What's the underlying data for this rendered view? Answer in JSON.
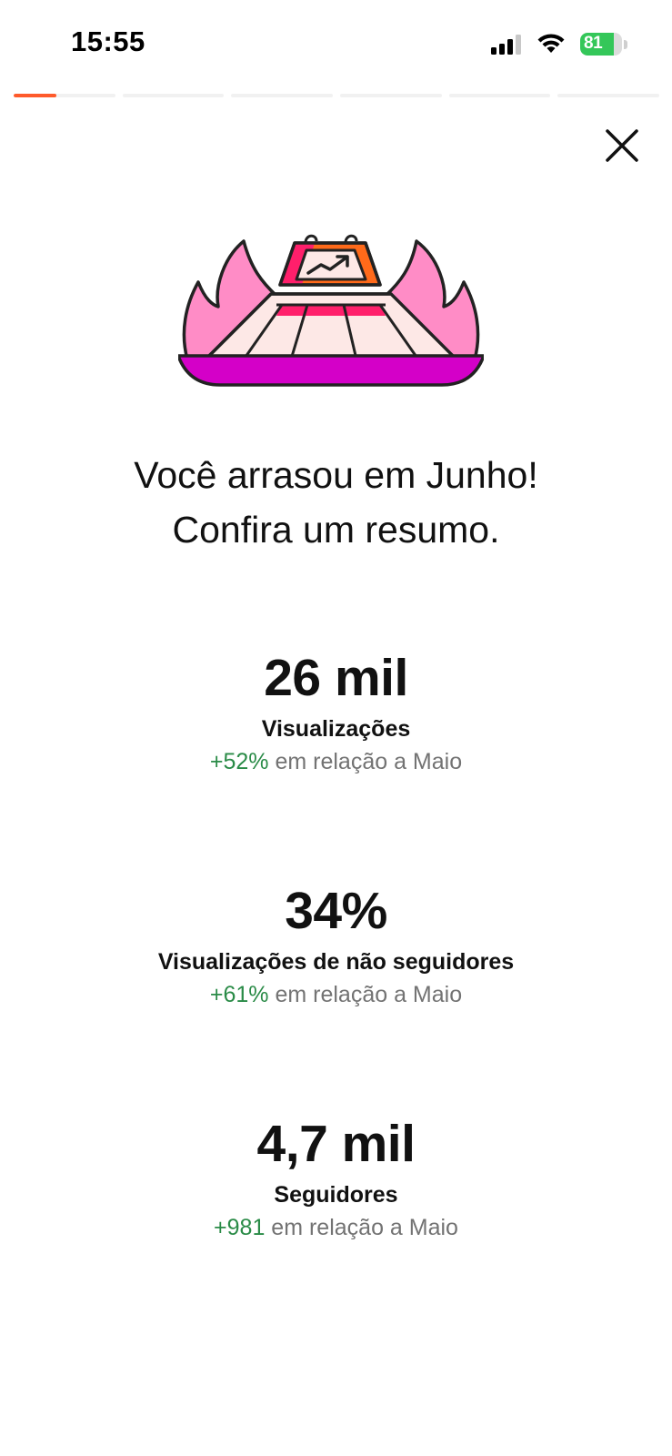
{
  "status_bar": {
    "time": "15:55",
    "battery_level": "81",
    "battery_fraction": 0.81,
    "icons": [
      "signal-icon",
      "wifi-icon",
      "battery-icon"
    ]
  },
  "story": {
    "segments_total": 6,
    "active_segment": 1,
    "active_progress": 0.42,
    "accent_color": "#fe5a2b"
  },
  "close_icon": "close-icon",
  "illustration_icon": "trophy-on-fire-icon",
  "headline": {
    "line1": "Você arrasou em Junho!",
    "line2": "Confira um resumo."
  },
  "stats": [
    {
      "value": "26 mil",
      "label": "Visualizações",
      "delta": "+52%",
      "comparison": "em relação a Maio"
    },
    {
      "value": "34%",
      "label": "Visualizações de não seguidores",
      "delta": "+61%",
      "comparison": "em relação a Maio"
    },
    {
      "value": "4,7 mil",
      "label": "Seguidores",
      "delta": "+981",
      "comparison": "em relação a Maio"
    }
  ],
  "colors": {
    "positive_delta": "#2a8b47",
    "secondary_text": "#737373",
    "flame_pink": "#ff8cc6",
    "base_magenta": "#d400c8",
    "stripe_red": "#ff1f6b",
    "screen_orange": "#ff6a1a"
  }
}
